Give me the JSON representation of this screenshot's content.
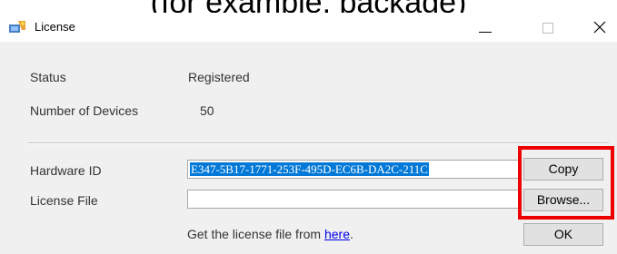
{
  "caption": {
    "text": "(for example, package)"
  },
  "window": {
    "title": "License",
    "icon": "license-app-icon",
    "controls": {
      "minimize": "minimize-icon",
      "maximize": "maximize-icon",
      "close": "close-icon"
    }
  },
  "status": {
    "label": "Status",
    "value": "Registered"
  },
  "devices": {
    "label": "Number of Devices",
    "value": "50"
  },
  "hardware": {
    "label": "Hardware ID",
    "value": "E347-5B17-1771-253F-495D-EC6B-DA2C-211C",
    "copy_label": "Copy"
  },
  "license_file": {
    "label": "License File",
    "value": "",
    "browse_label": "Browse..."
  },
  "hint": {
    "prefix": "Get the license file from ",
    "link": "here",
    "suffix": "."
  },
  "ok_label": "OK",
  "colors": {
    "highlight_box": "#ee0000",
    "selection": "#0078d7",
    "link": "#0000ee"
  }
}
